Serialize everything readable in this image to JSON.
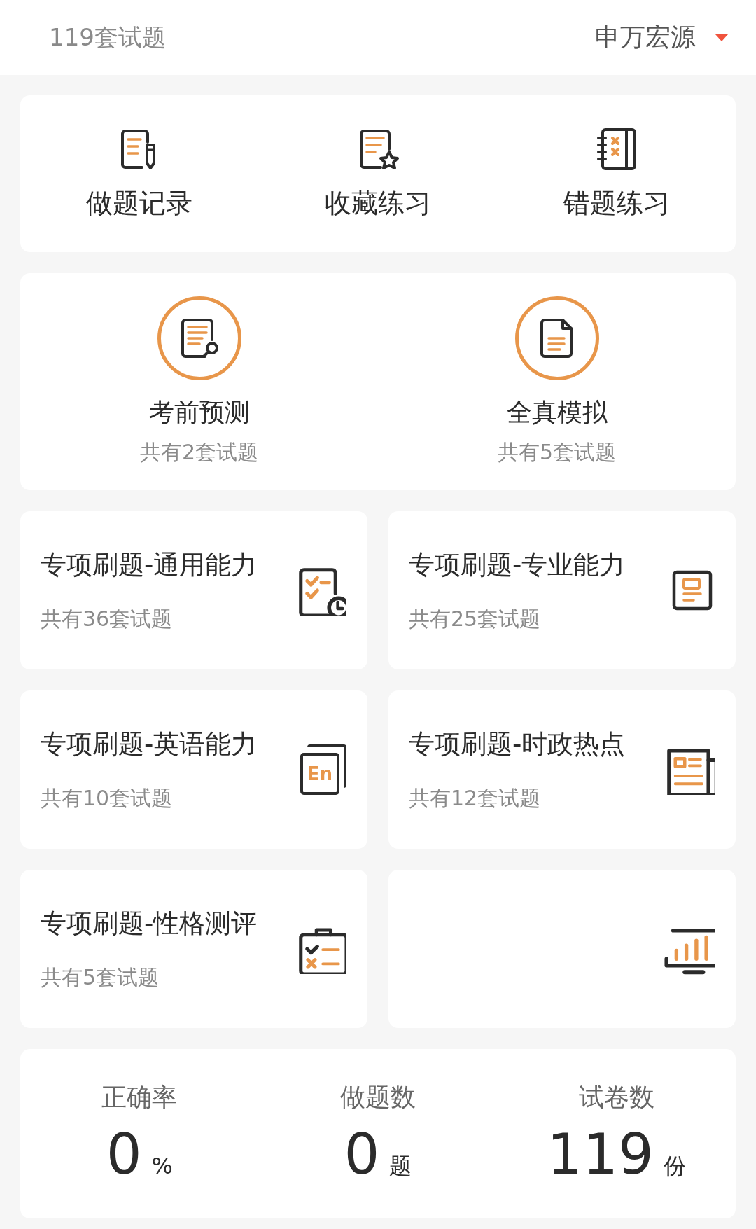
{
  "header": {
    "count_label": "119套试题",
    "bank": "申万宏源"
  },
  "quick_actions": [
    {
      "label": "做题记录"
    },
    {
      "label": "收藏练习"
    },
    {
      "label": "错题练习"
    }
  ],
  "featured": [
    {
      "title": "考前预测",
      "subtitle": "共有2套试题"
    },
    {
      "title": "全真模拟",
      "subtitle": "共有5套试题"
    }
  ],
  "topics": [
    {
      "kind": "text",
      "title": "专项刷题-通用能力",
      "subtitle": "共有36套试题"
    },
    {
      "kind": "text",
      "title": "专项刷题-专业能力",
      "subtitle": "共有25套试题"
    },
    {
      "kind": "text",
      "title": "专项刷题-英语能力",
      "subtitle": "共有10套试题",
      "icon_text": "En"
    },
    {
      "kind": "text",
      "title": "专项刷题-时政热点",
      "subtitle": "共有12套试题"
    },
    {
      "kind": "text",
      "title": "专项刷题-性格测评",
      "subtitle": "共有5套试题"
    },
    {
      "kind": "icon_only"
    }
  ],
  "stats": [
    {
      "label": "正确率",
      "value": "0",
      "unit": "%"
    },
    {
      "label": "做题数",
      "value": "0",
      "unit": "题"
    },
    {
      "label": "试卷数",
      "value": "119",
      "unit": "份"
    }
  ]
}
